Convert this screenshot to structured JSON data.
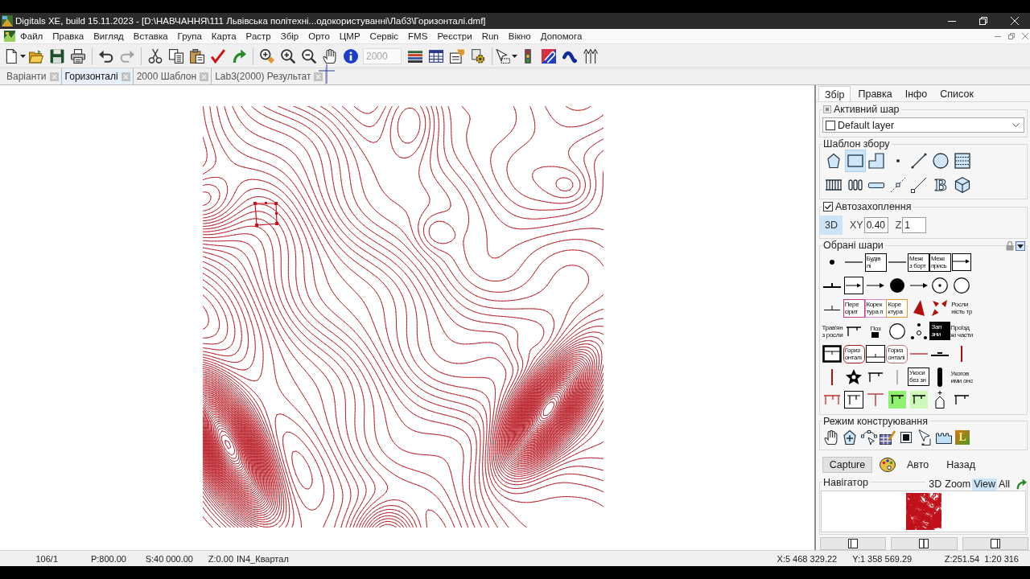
{
  "window": {
    "title": "Digitals XE, build 15.11.2023 - [D:\\НАВЧАННЯ\\111 Львівська політехні...одокористуванні\\Лаб3\\Горизонталі.dmf]"
  },
  "menu": [
    "Файл",
    "Правка",
    "Вигляд",
    "Вставка",
    "Група",
    "Карта",
    "Растр",
    "Збір",
    "Орто",
    "ЦМР",
    "Сервіс",
    "FMS",
    "Реєстри",
    "Run",
    "Вікно",
    "Допомога"
  ],
  "toolbar": [
    [
      {
        "kind": "button",
        "disabled": false
      },
      {
        "kind": "button",
        "disabled": false
      },
      {
        "kind": "button",
        "disabled": false
      },
      {
        "kind": "button",
        "disabled": false
      }
    ],
    [
      {
        "kind": "button",
        "disabled": false
      },
      {
        "kind": "button",
        "disabled": true
      }
    ],
    [
      {
        "kind": "button",
        "disabled": false
      },
      {
        "kind": "button",
        "disabled": false
      },
      {
        "kind": "button",
        "disabled": false
      },
      {
        "kind": "button",
        "disabled": false
      },
      {
        "kind": "button",
        "disabled": false
      }
    ],
    [
      {
        "kind": "button",
        "disabled": false
      },
      {
        "kind": "button",
        "disabled": false
      },
      {
        "kind": "button",
        "disabled": false
      },
      {
        "kind": "button",
        "disabled": false
      },
      {
        "kind": "button",
        "disabled": false
      },
      {
        "kind": "field",
        "value": "2000",
        "disabled": true
      },
      {
        "kind": "button",
        "disabled": false
      },
      {
        "kind": "button",
        "disabled": false
      },
      {
        "kind": "button",
        "disabled": false
      },
      {
        "kind": "button",
        "disabled": false
      }
    ],
    [
      {
        "kind": "button",
        "disabled": false
      },
      {
        "kind": "button",
        "disabled": false
      },
      {
        "kind": "button",
        "disabled": false
      },
      {
        "kind": "button",
        "disabled": false
      },
      {
        "kind": "button",
        "disabled": false
      }
    ]
  ],
  "doc_tabs": [
    {
      "label": "Варіанти",
      "selected": false
    },
    {
      "label": "Горизонталі",
      "selected": true
    },
    {
      "label": "2000 Шаблон",
      "selected": false
    },
    {
      "label": "Lab3(2000) Результат",
      "selected": false
    }
  ],
  "panel": {
    "tabs": [
      {
        "label": "Збір",
        "selected": true
      },
      {
        "label": "Правка",
        "selected": false
      },
      {
        "label": "Інфо",
        "selected": false
      },
      {
        "label": "Список",
        "selected": false
      }
    ],
    "active_layer": {
      "title": "Активний шар",
      "value": "Default layer"
    },
    "capture_template": {
      "title": "Шаблон збору",
      "tools": [
        {
          "selected": false
        },
        {
          "selected": true
        },
        {
          "selected": false
        },
        {
          "selected": false
        },
        {
          "selected": false
        },
        {
          "selected": false
        },
        {
          "selected": false
        },
        {
          "selected": false
        },
        {
          "selected": false
        },
        {
          "selected": false
        },
        {
          "selected": false
        },
        {
          "selected": false
        },
        {
          "selected": false,
          "glyph": "B"
        },
        {
          "selected": false
        }
      ]
    },
    "autosnap": {
      "label": "Автозахоплення",
      "checked": true,
      "mode_3d": {
        "label": "3D",
        "on": true
      },
      "xy": {
        "label": "XY",
        "value": "0.40"
      },
      "z": {
        "label": "Z",
        "value": "1"
      }
    },
    "selected_layers": {
      "title": "Обрані шари",
      "rows": [
        [
          {
            "kind": "symbol"
          },
          {
            "kind": "symbol"
          },
          {
            "kind": "box",
            "lines": [
              "Будів",
              "лі"
            ],
            "color": "#000000"
          },
          {
            "kind": "symbol"
          },
          {
            "kind": "box",
            "lines": [
              "Межі",
              "з борт"
            ],
            "color": "#000000"
          },
          {
            "kind": "box",
            "lines": [
              "Межі",
              "прись"
            ],
            "color": "#000000"
          },
          {
            "kind": "symbol"
          }
        ],
        [
          {
            "kind": "symbol"
          },
          {
            "kind": "symbol"
          },
          {
            "kind": "symbol"
          },
          {
            "kind": "symbol"
          },
          {
            "kind": "symbol"
          },
          {
            "kind": "symbol"
          },
          {
            "kind": "symbol"
          }
        ],
        [
          {
            "kind": "symbol"
          },
          {
            "kind": "box",
            "lines": [
              "Пере",
              "сірит"
            ],
            "color": "#d6338a"
          },
          {
            "kind": "box",
            "lines": [
              "Корек",
              "тура п"
            ],
            "color": "#d98ad8"
          },
          {
            "kind": "box",
            "lines": [
              "Коре",
              "ктура"
            ],
            "color": "#e8962e"
          },
          {
            "kind": "symbol"
          },
          {
            "kind": "symbol"
          },
          {
            "kind": "caption",
            "lines": [
              "Росли",
              "ність тр"
            ]
          }
        ],
        [
          {
            "kind": "caption",
            "lines": [
              "Трав'ян",
              "з росли"
            ]
          },
          {
            "kind": "symbol"
          },
          {
            "kind": "stamp",
            "lines": [
              "Поз"
            ]
          },
          {
            "kind": "symbol"
          },
          {
            "kind": "symbol"
          },
          {
            "kind": "solid",
            "lines": [
              "Зап",
              "зни"
            ],
            "color": "#000000"
          },
          {
            "kind": "caption",
            "lines": [
              "Проїзд",
              "жі части"
            ]
          }
        ],
        [
          {
            "kind": "symbol"
          },
          {
            "kind": "rounded",
            "lines": [
              "Гориз",
              "онталі"
            ],
            "color": "#a01818"
          },
          {
            "kind": "symbol"
          },
          {
            "kind": "rounded",
            "lines": [
              "Гориз",
              "онталі"
            ],
            "color": "#c07070"
          },
          {
            "kind": "symbol"
          },
          {
            "kind": "symbol"
          },
          {
            "kind": "symbol"
          }
        ],
        [
          {
            "kind": "symbol"
          },
          {
            "kind": "symbol"
          },
          {
            "kind": "symbol"
          },
          {
            "kind": "symbol"
          },
          {
            "kind": "box",
            "lines": [
              "Укоси",
              "без зн"
            ],
            "color": "#000000"
          },
          {
            "kind": "symbol"
          },
          {
            "kind": "caption",
            "lines": [
              "Укогов",
              "ими онс"
            ]
          }
        ],
        [
          {
            "kind": "symbol"
          },
          {
            "kind": "symbol"
          },
          {
            "kind": "symbol"
          },
          {
            "kind": "symbol"
          },
          {
            "kind": "symbol"
          },
          {
            "kind": "symbol"
          },
          {
            "kind": "symbol"
          }
        ]
      ]
    },
    "construction_mode": {
      "title": "Режим конструювання",
      "tools": [
        {
          "selected": false
        },
        {
          "selected": false
        },
        {
          "selected": false
        },
        {
          "selected": false
        },
        {
          "selected": false
        },
        {
          "selected": false
        },
        {
          "selected": false
        },
        {
          "selected": false,
          "glyph": "L"
        }
      ]
    },
    "capture_button": "Capture",
    "auto_button": "Авто",
    "back_button": "Назад",
    "navigator": {
      "title": "Навігатор",
      "modes": [
        {
          "label": "3D",
          "selected": false
        },
        {
          "label": "Zoom",
          "selected": false
        },
        {
          "label": "View",
          "selected": true
        },
        {
          "label": "All",
          "selected": false
        }
      ]
    }
  },
  "status_bar": {
    "left": [
      "106/1",
      "P:800.00",
      "S:40 000.00",
      "Z:0.00",
      "IN4_Квартал"
    ],
    "right": [
      "X:5 468 329.22",
      "Y:1 358 569.29",
      "Z:251.54",
      "1:20 316"
    ]
  }
}
